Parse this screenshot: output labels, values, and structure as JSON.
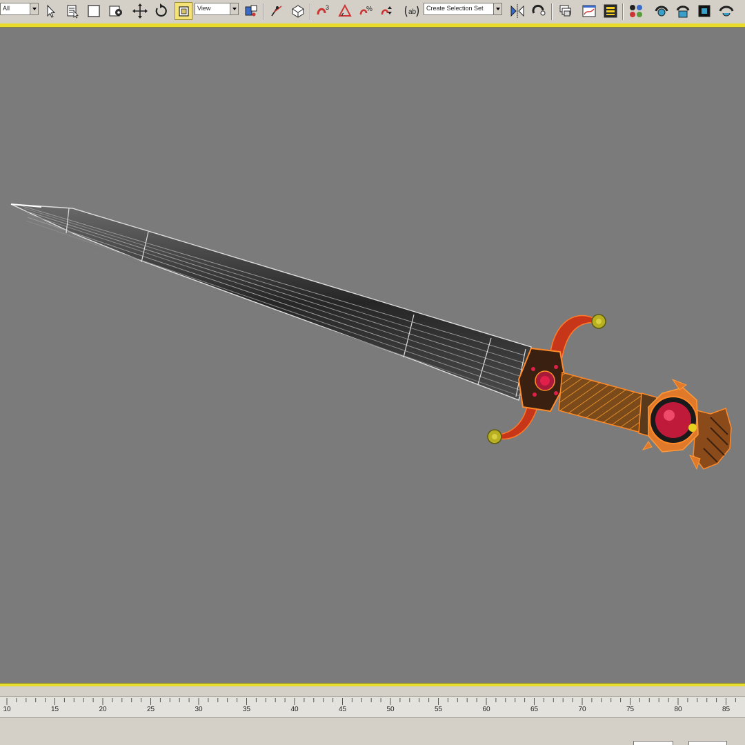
{
  "toolbar": {
    "selection_filter_value": "All",
    "reference_coordinate_value": "View",
    "named_selection_placeholder": "Create Selection Set",
    "accent_color": "#e8dc2c"
  },
  "icons": [
    "filter-dropdown-arrow-icon",
    "select-object-icon",
    "select-by-name-icon",
    "rectangular-selection-icon",
    "window-crossing-icon",
    "select-and-move-icon",
    "select-and-rotate-icon",
    "select-and-scale-icon",
    "reference-coordinate-icon",
    "use-pivot-center-icon",
    "select-and-manipulate-icon",
    "snaps-toggle-icon",
    "angle-snap-icon",
    "percent-snap-icon",
    "spinner-snap-icon",
    "edit-named-selection-icon",
    "mirror-icon",
    "align-icon",
    "layer-manager-icon",
    "curve-editor-icon",
    "schematic-view-icon",
    "material-editor-icon",
    "render-setup-icon",
    "render-frame-icon",
    "quick-render-icon"
  ],
  "viewport": {
    "background_color": "#7b7b7b",
    "object": "sword"
  },
  "timeline": {
    "ticks": [
      "10",
      "15",
      "20",
      "25",
      "30",
      "35",
      "40",
      "45",
      "50",
      "55",
      "60",
      "65",
      "70",
      "75",
      "80",
      "85"
    ]
  }
}
